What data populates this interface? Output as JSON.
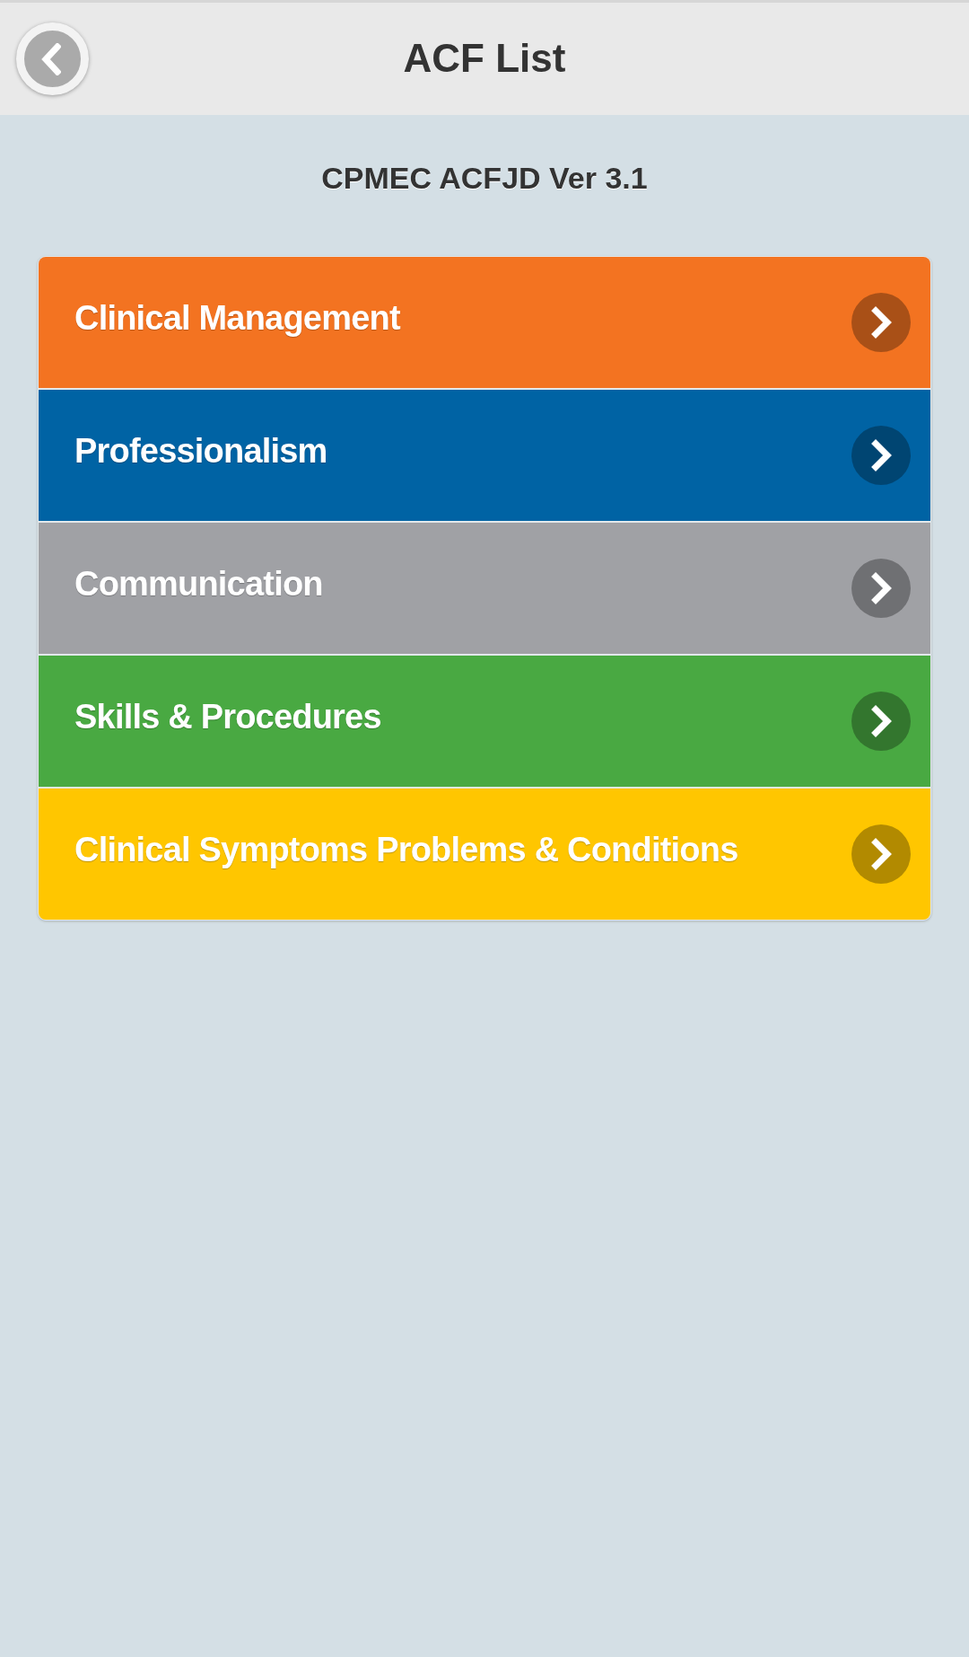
{
  "header": {
    "title": "ACF List"
  },
  "subtitle": "CPMEC ACFJD Ver 3.1",
  "items": [
    {
      "label": "Clinical Management",
      "color": "#f37321"
    },
    {
      "label": "Professionalism",
      "color": "#0063a4"
    },
    {
      "label": "Communication",
      "color": "#a0a1a5"
    },
    {
      "label": "Skills & Procedures",
      "color": "#49a942"
    },
    {
      "label": "Clinical Symptoms Problems & Conditions",
      "color": "#ffc600"
    }
  ]
}
